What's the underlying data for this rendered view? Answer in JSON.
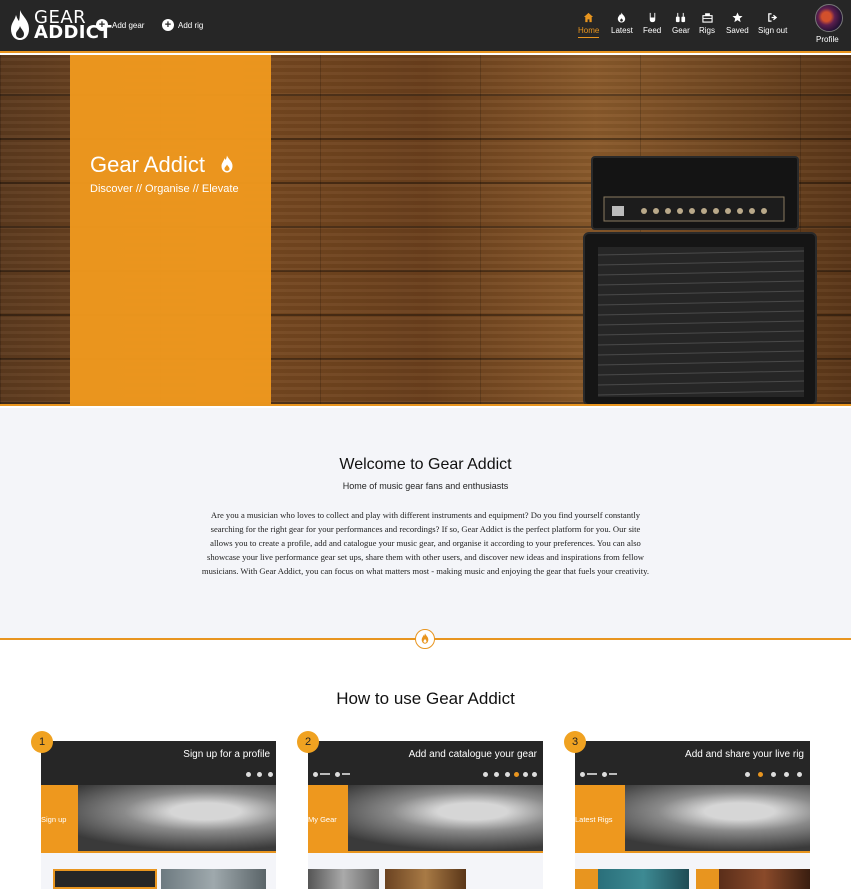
{
  "brand": {
    "top": "GEAR",
    "bottom": "ADDICT"
  },
  "nav_actions": [
    {
      "label": "Add gear",
      "icon": "plus-circle-icon"
    },
    {
      "label": "Add rig",
      "icon": "plus-circle-icon"
    }
  ],
  "nav_items": [
    {
      "label": "Home",
      "icon": "home-icon",
      "active": true
    },
    {
      "label": "Latest",
      "icon": "flame-icon",
      "active": false
    },
    {
      "label": "Feed",
      "icon": "rock-hand-icon",
      "active": false
    },
    {
      "label": "Gear",
      "icon": "guitar-amp-icon",
      "active": false
    },
    {
      "label": "Rigs",
      "icon": "toolbox-icon",
      "active": false
    },
    {
      "label": "Saved",
      "icon": "star-icon",
      "active": false
    },
    {
      "label": "Sign out",
      "icon": "sign-out-icon",
      "active": false
    }
  ],
  "profile": {
    "label": "Profile"
  },
  "hero": {
    "title": "Gear Addict",
    "subtitle": "Discover // Organise // Elevate"
  },
  "welcome": {
    "title": "Welcome to Gear Addict",
    "subtitle": "Home of music gear fans and enthusiasts",
    "body": "Are you a musician who loves to collect and play with different instruments and equipment? Do you find yourself constantly searching for the right gear for your performances and recordings? If so, Gear Addict is the perfect platform for you. Our site allows you to create a profile, add and catalogue your music gear, and organise it according to your preferences. You can also showcase your live performance gear set ups, share them with other users, and discover new ideas and inspirations from fellow musicians. With Gear Addict, you can focus on what matters most - making music and enjoying the gear that fuels your creativity."
  },
  "how_to": {
    "title": "How to use Gear Addict",
    "steps": [
      {
        "number": "1",
        "caption": "Sign up for a profile",
        "hero_text": "Sign up"
      },
      {
        "number": "2",
        "caption": "Add and catalogue your gear",
        "hero_text": "My Gear"
      },
      {
        "number": "3",
        "caption": "Add and share your live rig",
        "hero_text": "Latest Rigs"
      }
    ]
  },
  "colors": {
    "accent": "#e8951f",
    "navbar": "#262626",
    "section_bg": "#f4f5f9"
  }
}
